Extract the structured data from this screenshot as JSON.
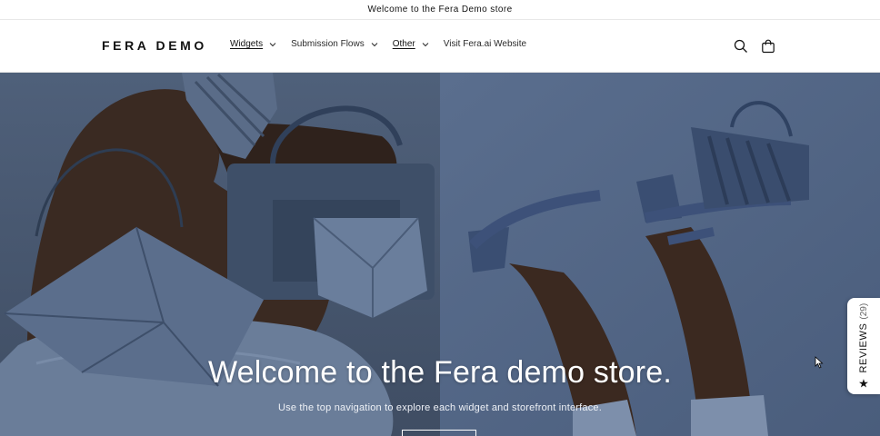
{
  "announcement": {
    "text": "Welcome to the Fera Demo store"
  },
  "header": {
    "logo": "FERA DEMO",
    "nav": [
      {
        "label": "Widgets",
        "has_dropdown": true,
        "active": true
      },
      {
        "label": "Submission Flows",
        "has_dropdown": true,
        "active": false
      },
      {
        "label": "Other",
        "has_dropdown": true,
        "active": true
      },
      {
        "label": "Visit Fera.ai Website",
        "has_dropdown": false,
        "active": false
      }
    ],
    "icons": [
      "search-icon",
      "cart-icon"
    ]
  },
  "hero": {
    "title": "Welcome to the Fera demo store.",
    "subtitle": "Use the top navigation to explore each widget and storefront interface."
  },
  "reviews_tab": {
    "label": "REVIEWS",
    "count": "(29)",
    "icon": "star-icon"
  },
  "colors": {
    "hero_left_bg": "#4a5b74",
    "hero_right_bg": "#556988",
    "accent": "#121212"
  }
}
